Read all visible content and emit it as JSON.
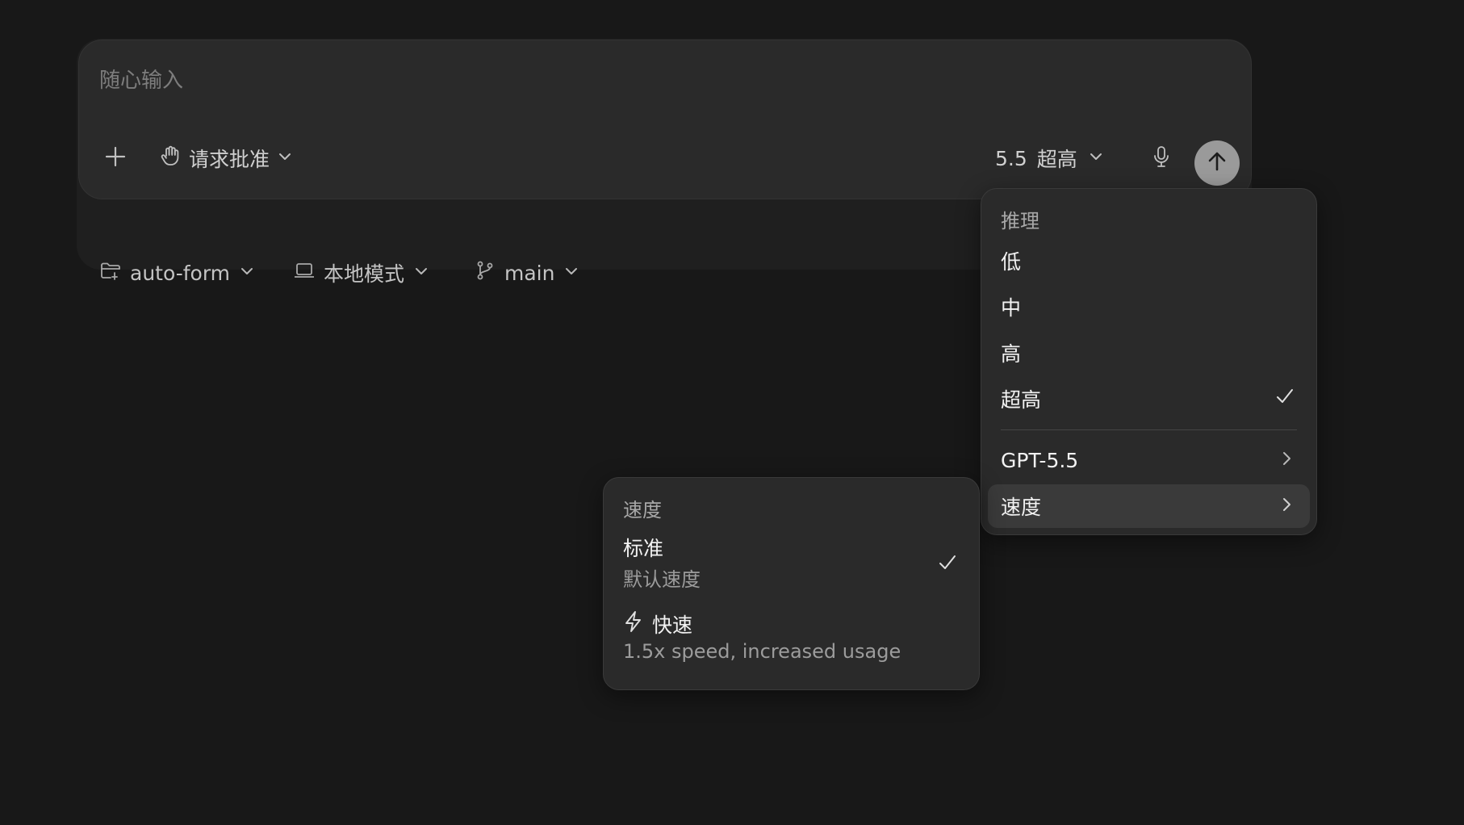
{
  "composer": {
    "placeholder": "随心输入",
    "approval_label": "请求批准",
    "model_version": "5.5",
    "reasoning_label": "超高"
  },
  "sub_bar": {
    "project_label": "auto-form",
    "mode_label": "本地模式",
    "branch_label": "main"
  },
  "model_menu": {
    "header": "推理",
    "reasoning_options": [
      {
        "label": "低",
        "selected": false
      },
      {
        "label": "中",
        "selected": false
      },
      {
        "label": "高",
        "selected": false
      },
      {
        "label": "超高",
        "selected": true
      }
    ],
    "model_label": "GPT-5.5",
    "speed_label": "速度"
  },
  "speed_menu": {
    "header": "速度",
    "options": [
      {
        "title": "标准",
        "description": "默认速度",
        "selected": true,
        "icon": null
      },
      {
        "title": "快速",
        "description": "1.5x speed, increased usage",
        "selected": false,
        "icon": "lightning-icon"
      }
    ]
  },
  "icons": {
    "add": "plus-icon",
    "approval": "hand-icon",
    "mic": "microphone-icon",
    "send": "arrow-up-icon",
    "project": "folder-icon",
    "mode": "laptop-icon",
    "branch": "git-branch-icon"
  },
  "colors": {
    "background": "#181818",
    "surface": "#2a2a2a",
    "send_button": "#9a9a9a"
  }
}
